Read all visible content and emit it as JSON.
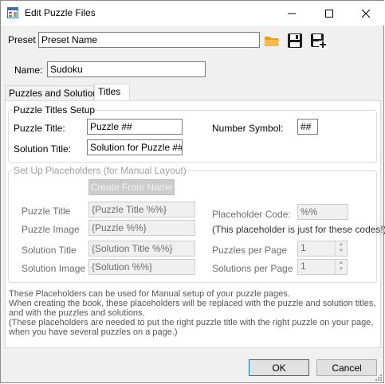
{
  "window": {
    "title": "Edit Puzzle Files"
  },
  "preset": {
    "label": "Preset",
    "value": "Preset Name"
  },
  "name": {
    "label": "Name:",
    "value": "Sudoku"
  },
  "tabs": [
    {
      "label": "Puzzles and Solutions"
    },
    {
      "label": "Titles"
    }
  ],
  "titles_group": {
    "legend": "Puzzle Titles Setup",
    "puzzle_title_label": "Puzzle Title:",
    "puzzle_title_value": "Puzzle ##",
    "solution_title_label": "Solution Title:",
    "solution_title_value": "Solution for Puzzle ##",
    "number_symbol_label": "Number Symbol:",
    "number_symbol_value": "##"
  },
  "placeholders_group": {
    "legend": "Set Up Placeholders (for Manual Layout)",
    "create_button": "Create From Name",
    "puzzle_title_label": "Puzzle Title",
    "puzzle_title_value": "{Puzzle Title %%}",
    "puzzle_image_label": "Puzzle Image",
    "puzzle_image_value": "{Puzzle %%}",
    "solution_title_label": "Solution Title",
    "solution_title_value": "{Solution Title %%}",
    "solution_image_label": "Solution Image",
    "solution_image_value": "{Solution %%}",
    "placeholder_code_label": "Placeholder Code:",
    "placeholder_code_value": "%%",
    "placeholder_note": "(This placeholder is just for these codes!)",
    "puzzles_per_page_label": "Puzzles per Page",
    "puzzles_per_page_value": "1",
    "solutions_per_page_label": "Solutions per Page",
    "solutions_per_page_value": "1"
  },
  "info_text": [
    "These Placeholders can be used for Manual setup of your puzzle pages.",
    "When creating the book, these placeholders will be replaced with the puzzle and solution titles, and with the puzzles and solutions.",
    "(These placeholders are needed to put the right puzzle title with the right puzzle on your page, when you have several puzzles on a page.)"
  ],
  "buttons": {
    "ok": "OK",
    "cancel": "Cancel"
  },
  "icons": {
    "open": "folder-open-icon",
    "save": "save-icon",
    "save_as": "save-as-icon"
  },
  "colors": {
    "folder": "#f2a93b",
    "focus_border": "#0078d7"
  }
}
